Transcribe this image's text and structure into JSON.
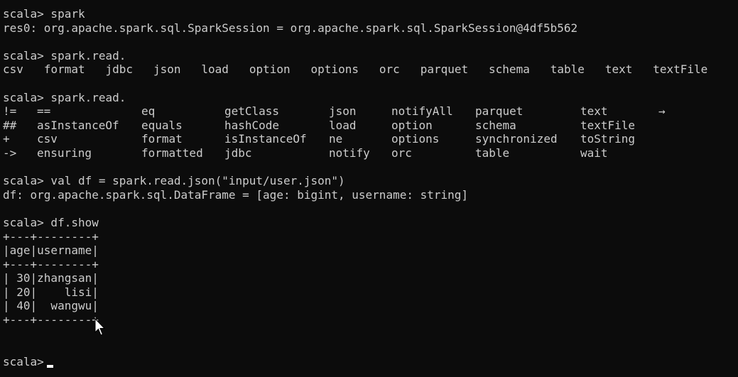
{
  "terminal": {
    "lines": {
      "l1": "scala> spark",
      "l2": "res0: org.apache.spark.sql.SparkSession = org.apache.spark.sql.SparkSession@4df5b562",
      "l4": "scala> spark.read.",
      "l7": "scala> spark.read.",
      "l13": "scala> val df = spark.read.json(\"input/user.json\")",
      "l14": "df: org.apache.spark.sql.DataFrame = [age: bigint, username: string]",
      "l16": "scala> df.show",
      "t1": "+---+--------+",
      "t2": "|age|username|",
      "t3": "+---+--------+",
      "t4": "| 30|zhangsan|",
      "t5": "| 20|    lisi|",
      "t6": "| 40|  wangwu|",
      "t7": "+---+--------+",
      "prompt": "scala>"
    },
    "completion_row1": [
      "csv",
      "format",
      "jdbc",
      "json",
      "load",
      "option",
      "options",
      "orc",
      "parquet",
      "schema",
      "table",
      "text",
      "textFile"
    ],
    "completion_grid": [
      [
        "!=",
        "==",
        "eq",
        "getClass",
        "json",
        "notifyAll",
        "parquet",
        "text",
        "→"
      ],
      [
        "##",
        "asInstanceOf",
        "equals",
        "hashCode",
        "load",
        "option",
        "schema",
        "textFile",
        ""
      ],
      [
        "+",
        "csv",
        "format",
        "isInstanceOf",
        "ne",
        "options",
        "synchronized",
        "toString",
        ""
      ],
      [
        "->",
        "ensuring",
        "formatted",
        "jdbc",
        "notify",
        "orc",
        "table",
        "wait",
        ""
      ]
    ]
  }
}
